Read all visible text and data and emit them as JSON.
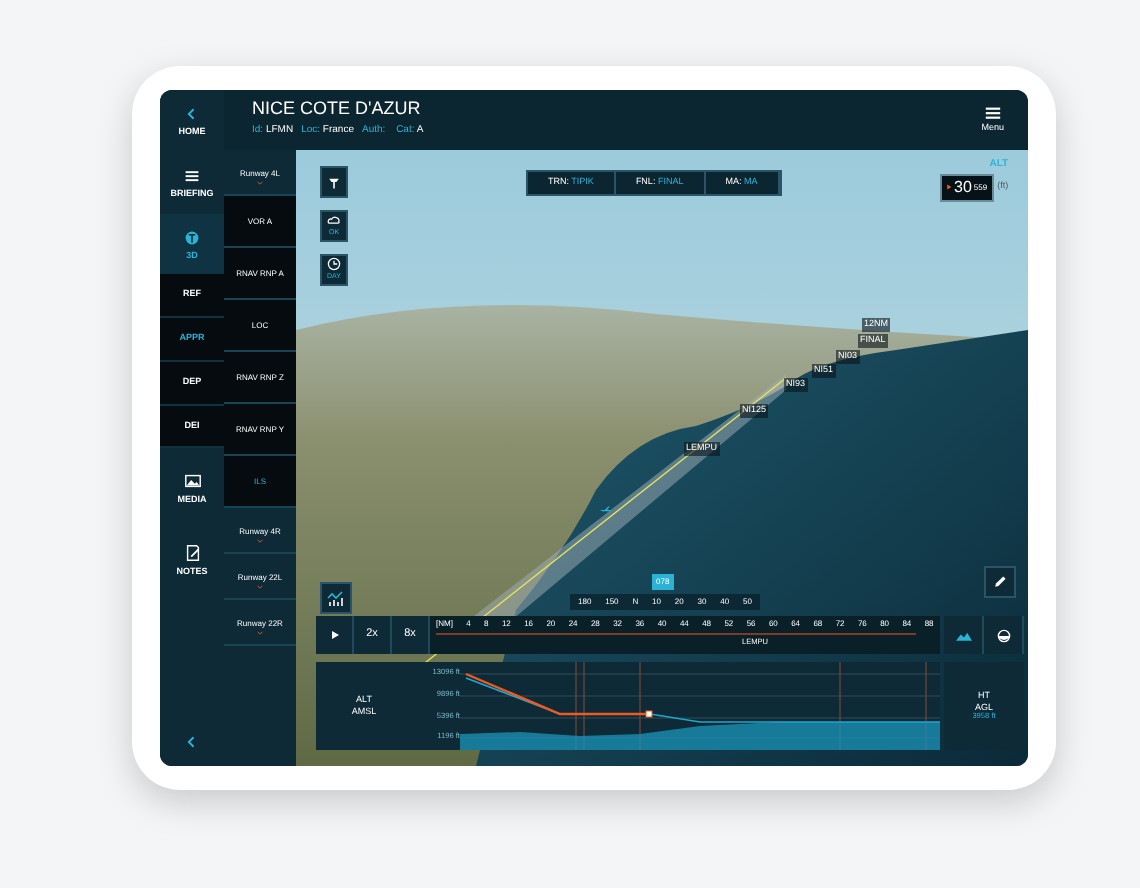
{
  "header": {
    "title": "NICE COTE D'AZUR",
    "info": [
      {
        "label": "Id:",
        "value": "LFMN"
      },
      {
        "label": "Loc:",
        "value": "France"
      },
      {
        "label": "Auth:"
      },
      {
        "label": "Cat:",
        "value": "A"
      }
    ],
    "menu_label": "Menu"
  },
  "rail": [
    {
      "kind": "home",
      "label": "HOME",
      "selected": false
    },
    {
      "kind": "briefing",
      "label": "BRIEFING",
      "selected": false
    },
    {
      "kind": "globe",
      "label": "3D",
      "selected": true
    }
  ],
  "subtabs": [
    {
      "label": "REF",
      "selected": false
    },
    {
      "label": "APPR",
      "selected": true
    },
    {
      "label": "DEP",
      "selected": false
    },
    {
      "label": "DEI",
      "selected": false
    }
  ],
  "rail_bottom": [
    {
      "kind": "media",
      "label": "MEDIA"
    },
    {
      "kind": "notes",
      "label": "NOTES"
    }
  ],
  "procedures": [
    {
      "kind": "runway",
      "label": "Runway 4L",
      "selected": false
    },
    {
      "kind": "procedure",
      "label": "VOR A",
      "selected": false
    },
    {
      "kind": "procedure",
      "label": "RNAV RNP A",
      "selected": false
    },
    {
      "kind": "procedure",
      "label": "LOC",
      "selected": false
    },
    {
      "kind": "procedure",
      "label": "RNAV RNP Z",
      "selected": false
    },
    {
      "kind": "procedure",
      "label": "RNAV RNP Y",
      "selected": false
    },
    {
      "kind": "procedure",
      "label": "ILS",
      "selected": true
    },
    {
      "kind": "runway",
      "label": "Runway 4R",
      "selected": false
    },
    {
      "kind": "runway",
      "label": "Runway 22L",
      "selected": false
    },
    {
      "kind": "runway",
      "label": "Runway 22R",
      "selected": false
    }
  ],
  "map_tools": [
    {
      "kind": "tower"
    },
    {
      "kind": "weather",
      "label": "OK"
    },
    {
      "kind": "clock",
      "label": "DAY"
    }
  ],
  "segments": [
    {
      "label": "TRN:",
      "value": "TIPIK"
    },
    {
      "label": "FNL:",
      "value": "FINAL"
    },
    {
      "label": "MA:",
      "value": "MA"
    }
  ],
  "altitude": {
    "label": "ALT",
    "value": "30",
    "small": "559",
    "unit": "(ft)"
  },
  "waypoints": [
    "12NM",
    "FINAL",
    "NI03",
    "NI51",
    "NI93",
    "NI125",
    "LEMPU"
  ],
  "heading_tape": [
    "180",
    "150",
    "N",
    "10",
    "20",
    "30",
    "40",
    "50"
  ],
  "heading_marker": "078",
  "playback": {
    "speeds": [
      "2x",
      "8x"
    ],
    "unit": "[NM]",
    "ticks": [
      "4",
      "8",
      "12",
      "16",
      "20",
      "24",
      "28",
      "32",
      "36",
      "40",
      "44",
      "48",
      "52",
      "56",
      "60",
      "64",
      "68",
      "72",
      "76",
      "80",
      "84",
      "88"
    ],
    "current_fix": "LEMPU"
  },
  "profile": {
    "label": [
      "ALT",
      "AMSL"
    ],
    "axis": [
      "13096 ft",
      "9896 ft",
      "5396 ft",
      "1196 ft"
    ],
    "right_label": [
      "HT",
      "AGL"
    ],
    "right_value": "3958 ft"
  }
}
